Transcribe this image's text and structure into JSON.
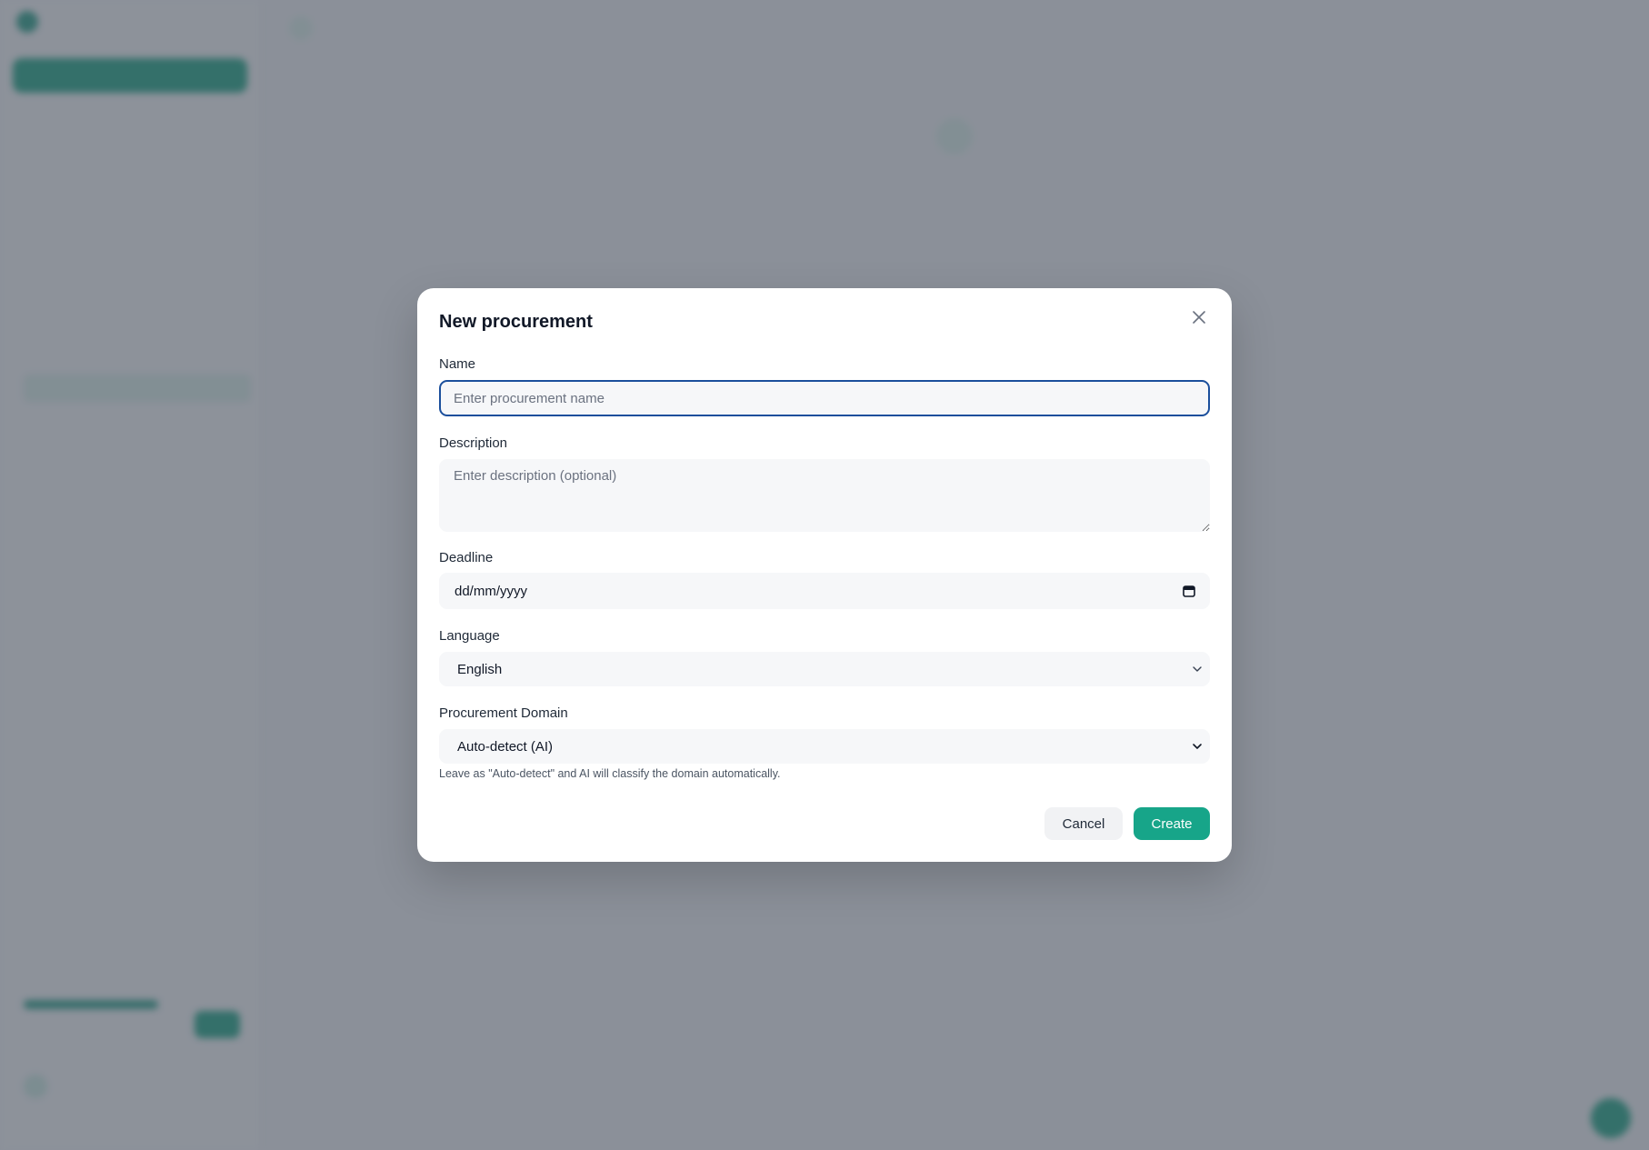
{
  "colors": {
    "accent": "#17a589",
    "focus_ring": "#1b4f9c",
    "overlay": "rgba(72,80,94,0.62)"
  },
  "modal": {
    "title": "New procurement",
    "close_icon": "close-icon",
    "name": {
      "label": "Name",
      "placeholder": "Enter procurement name",
      "value": ""
    },
    "description": {
      "label": "Description",
      "placeholder": "Enter description (optional)",
      "value": ""
    },
    "deadline": {
      "label": "Deadline",
      "value": "dd/mm/yyyy",
      "icon": "calendar-icon"
    },
    "language": {
      "label": "Language",
      "selected": "English",
      "icon": "chevron-down-icon"
    },
    "domain": {
      "label": "Procurement Domain",
      "selected": "Auto-detect (AI)",
      "hint": "Leave as \"Auto-detect\" and AI will classify the domain automatically.",
      "icon": "chevron-down-icon"
    },
    "cancel_label": "Cancel",
    "create_label": "Create"
  }
}
